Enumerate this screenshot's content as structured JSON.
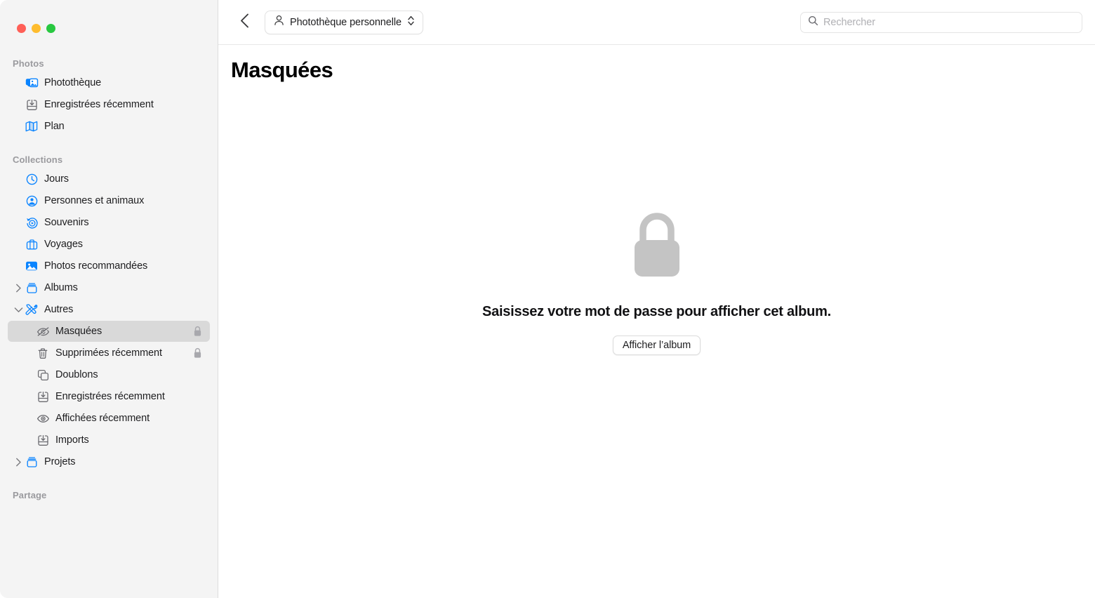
{
  "window": {
    "traffic_lights": [
      {
        "name": "close",
        "color": "#ff5f57"
      },
      {
        "name": "minimize",
        "color": "#febc2e"
      },
      {
        "name": "maximize",
        "color": "#28c840"
      }
    ]
  },
  "toolbar": {
    "back_icon": "chevron-left-icon",
    "library_popup": {
      "icon": "person-icon",
      "label": "Photothèque personnelle",
      "indicator_icon": "chevron-up-down-icon"
    },
    "search": {
      "icon": "search-icon",
      "placeholder": "Rechercher",
      "value": ""
    }
  },
  "sidebar": {
    "sections": [
      {
        "header": "Photos",
        "items": [
          {
            "label": "Photothèque",
            "icon": "photo-stack-icon",
            "level": 1,
            "icon_color": "#0a84ff",
            "selected": false,
            "locked": false,
            "twisty": "none"
          },
          {
            "label": "Enregistrées récemment",
            "icon": "tray-download-icon",
            "level": 1,
            "icon_color": "#8e8e93",
            "selected": false,
            "locked": false,
            "twisty": "none"
          },
          {
            "label": "Plan",
            "icon": "map-icon",
            "level": 1,
            "icon_color": "#0a84ff",
            "selected": false,
            "locked": false,
            "twisty": "none"
          }
        ]
      },
      {
        "header": "Collections",
        "items": [
          {
            "label": "Jours",
            "icon": "clock-icon",
            "level": 1,
            "icon_color": "#0a84ff",
            "selected": false,
            "locked": false,
            "twisty": "none"
          },
          {
            "label": "Personnes et animaux",
            "icon": "person-circle-icon",
            "level": 1,
            "icon_color": "#0a84ff",
            "selected": false,
            "locked": false,
            "twisty": "none"
          },
          {
            "label": "Souvenirs",
            "icon": "memories-icon",
            "level": 1,
            "icon_color": "#0a84ff",
            "selected": false,
            "locked": false,
            "twisty": "none"
          },
          {
            "label": "Voyages",
            "icon": "suitcase-icon",
            "level": 1,
            "icon_color": "#0a84ff",
            "selected": false,
            "locked": false,
            "twisty": "none"
          },
          {
            "label": "Photos recommandées",
            "icon": "photo-fill-icon",
            "level": 1,
            "icon_color": "#0a84ff",
            "selected": false,
            "locked": false,
            "twisty": "none"
          },
          {
            "label": "Albums",
            "icon": "album-box-icon",
            "level": 0,
            "icon_color": "#0a84ff",
            "selected": false,
            "locked": false,
            "twisty": "collapsed"
          },
          {
            "label": "Autres",
            "icon": "tools-icon",
            "level": 0,
            "icon_color": "#0a84ff",
            "selected": false,
            "locked": false,
            "twisty": "expanded"
          },
          {
            "label": "Masquées",
            "icon": "eye-slash-icon",
            "level": 2,
            "icon_color": "#6b6b70",
            "selected": true,
            "locked": true,
            "twisty": "none"
          },
          {
            "label": "Supprimées récemment",
            "icon": "trash-icon",
            "level": 2,
            "icon_color": "#6b6b70",
            "selected": false,
            "locked": true,
            "twisty": "none"
          },
          {
            "label": "Doublons",
            "icon": "duplicate-icon",
            "level": 2,
            "icon_color": "#6b6b70",
            "selected": false,
            "locked": false,
            "twisty": "none"
          },
          {
            "label": "Enregistrées récemment",
            "icon": "tray-download-icon",
            "level": 2,
            "icon_color": "#6b6b70",
            "selected": false,
            "locked": false,
            "twisty": "none"
          },
          {
            "label": "Affichées récemment",
            "icon": "eye-icon",
            "level": 2,
            "icon_color": "#6b6b70",
            "selected": false,
            "locked": false,
            "twisty": "none"
          },
          {
            "label": "Imports",
            "icon": "tray-download-icon",
            "level": 2,
            "icon_color": "#6b6b70",
            "selected": false,
            "locked": false,
            "twisty": "none"
          },
          {
            "label": "Projets",
            "icon": "album-box-icon",
            "level": 0,
            "icon_color": "#0a84ff",
            "selected": false,
            "locked": false,
            "twisty": "collapsed"
          }
        ]
      },
      {
        "header": "Partage",
        "items": []
      }
    ]
  },
  "main": {
    "page_title": "Masquées",
    "empty_state": {
      "icon": "lock-icon",
      "message": "Saisissez votre mot de passe pour afficher cet album.",
      "button_label": "Afficher l’album"
    }
  },
  "colors": {
    "accent_blue": "#0a84ff",
    "sidebar_bg": "#f4f4f4",
    "selected_row": "#d9d9d9",
    "lock_gray": "#c4c4c4",
    "section_header": "#9a9a9e"
  }
}
